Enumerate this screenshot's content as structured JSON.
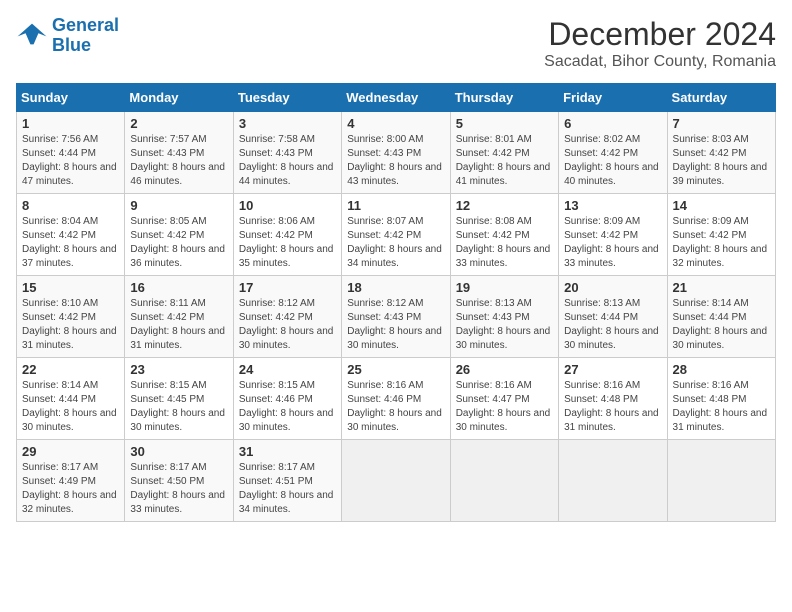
{
  "header": {
    "logo_line1": "General",
    "logo_line2": "Blue",
    "title": "December 2024",
    "subtitle": "Sacadat, Bihor County, Romania"
  },
  "calendar": {
    "columns": [
      "Sunday",
      "Monday",
      "Tuesday",
      "Wednesday",
      "Thursday",
      "Friday",
      "Saturday"
    ],
    "weeks": [
      [
        {
          "day": "1",
          "sunrise": "Sunrise: 7:56 AM",
          "sunset": "Sunset: 4:44 PM",
          "daylight": "Daylight: 8 hours and 47 minutes."
        },
        {
          "day": "2",
          "sunrise": "Sunrise: 7:57 AM",
          "sunset": "Sunset: 4:43 PM",
          "daylight": "Daylight: 8 hours and 46 minutes."
        },
        {
          "day": "3",
          "sunrise": "Sunrise: 7:58 AM",
          "sunset": "Sunset: 4:43 PM",
          "daylight": "Daylight: 8 hours and 44 minutes."
        },
        {
          "day": "4",
          "sunrise": "Sunrise: 8:00 AM",
          "sunset": "Sunset: 4:43 PM",
          "daylight": "Daylight: 8 hours and 43 minutes."
        },
        {
          "day": "5",
          "sunrise": "Sunrise: 8:01 AM",
          "sunset": "Sunset: 4:42 PM",
          "daylight": "Daylight: 8 hours and 41 minutes."
        },
        {
          "day": "6",
          "sunrise": "Sunrise: 8:02 AM",
          "sunset": "Sunset: 4:42 PM",
          "daylight": "Daylight: 8 hours and 40 minutes."
        },
        {
          "day": "7",
          "sunrise": "Sunrise: 8:03 AM",
          "sunset": "Sunset: 4:42 PM",
          "daylight": "Daylight: 8 hours and 39 minutes."
        }
      ],
      [
        {
          "day": "8",
          "sunrise": "Sunrise: 8:04 AM",
          "sunset": "Sunset: 4:42 PM",
          "daylight": "Daylight: 8 hours and 37 minutes."
        },
        {
          "day": "9",
          "sunrise": "Sunrise: 8:05 AM",
          "sunset": "Sunset: 4:42 PM",
          "daylight": "Daylight: 8 hours and 36 minutes."
        },
        {
          "day": "10",
          "sunrise": "Sunrise: 8:06 AM",
          "sunset": "Sunset: 4:42 PM",
          "daylight": "Daylight: 8 hours and 35 minutes."
        },
        {
          "day": "11",
          "sunrise": "Sunrise: 8:07 AM",
          "sunset": "Sunset: 4:42 PM",
          "daylight": "Daylight: 8 hours and 34 minutes."
        },
        {
          "day": "12",
          "sunrise": "Sunrise: 8:08 AM",
          "sunset": "Sunset: 4:42 PM",
          "daylight": "Daylight: 8 hours and 33 minutes."
        },
        {
          "day": "13",
          "sunrise": "Sunrise: 8:09 AM",
          "sunset": "Sunset: 4:42 PM",
          "daylight": "Daylight: 8 hours and 33 minutes."
        },
        {
          "day": "14",
          "sunrise": "Sunrise: 8:09 AM",
          "sunset": "Sunset: 4:42 PM",
          "daylight": "Daylight: 8 hours and 32 minutes."
        }
      ],
      [
        {
          "day": "15",
          "sunrise": "Sunrise: 8:10 AM",
          "sunset": "Sunset: 4:42 PM",
          "daylight": "Daylight: 8 hours and 31 minutes."
        },
        {
          "day": "16",
          "sunrise": "Sunrise: 8:11 AM",
          "sunset": "Sunset: 4:42 PM",
          "daylight": "Daylight: 8 hours and 31 minutes."
        },
        {
          "day": "17",
          "sunrise": "Sunrise: 8:12 AM",
          "sunset": "Sunset: 4:42 PM",
          "daylight": "Daylight: 8 hours and 30 minutes."
        },
        {
          "day": "18",
          "sunrise": "Sunrise: 8:12 AM",
          "sunset": "Sunset: 4:43 PM",
          "daylight": "Daylight: 8 hours and 30 minutes."
        },
        {
          "day": "19",
          "sunrise": "Sunrise: 8:13 AM",
          "sunset": "Sunset: 4:43 PM",
          "daylight": "Daylight: 8 hours and 30 minutes."
        },
        {
          "day": "20",
          "sunrise": "Sunrise: 8:13 AM",
          "sunset": "Sunset: 4:44 PM",
          "daylight": "Daylight: 8 hours and 30 minutes."
        },
        {
          "day": "21",
          "sunrise": "Sunrise: 8:14 AM",
          "sunset": "Sunset: 4:44 PM",
          "daylight": "Daylight: 8 hours and 30 minutes."
        }
      ],
      [
        {
          "day": "22",
          "sunrise": "Sunrise: 8:14 AM",
          "sunset": "Sunset: 4:44 PM",
          "daylight": "Daylight: 8 hours and 30 minutes."
        },
        {
          "day": "23",
          "sunrise": "Sunrise: 8:15 AM",
          "sunset": "Sunset: 4:45 PM",
          "daylight": "Daylight: 8 hours and 30 minutes."
        },
        {
          "day": "24",
          "sunrise": "Sunrise: 8:15 AM",
          "sunset": "Sunset: 4:46 PM",
          "daylight": "Daylight: 8 hours and 30 minutes."
        },
        {
          "day": "25",
          "sunrise": "Sunrise: 8:16 AM",
          "sunset": "Sunset: 4:46 PM",
          "daylight": "Daylight: 8 hours and 30 minutes."
        },
        {
          "day": "26",
          "sunrise": "Sunrise: 8:16 AM",
          "sunset": "Sunset: 4:47 PM",
          "daylight": "Daylight: 8 hours and 30 minutes."
        },
        {
          "day": "27",
          "sunrise": "Sunrise: 8:16 AM",
          "sunset": "Sunset: 4:48 PM",
          "daylight": "Daylight: 8 hours and 31 minutes."
        },
        {
          "day": "28",
          "sunrise": "Sunrise: 8:16 AM",
          "sunset": "Sunset: 4:48 PM",
          "daylight": "Daylight: 8 hours and 31 minutes."
        }
      ],
      [
        {
          "day": "29",
          "sunrise": "Sunrise: 8:17 AM",
          "sunset": "Sunset: 4:49 PM",
          "daylight": "Daylight: 8 hours and 32 minutes."
        },
        {
          "day": "30",
          "sunrise": "Sunrise: 8:17 AM",
          "sunset": "Sunset: 4:50 PM",
          "daylight": "Daylight: 8 hours and 33 minutes."
        },
        {
          "day": "31",
          "sunrise": "Sunrise: 8:17 AM",
          "sunset": "Sunset: 4:51 PM",
          "daylight": "Daylight: 8 hours and 34 minutes."
        },
        null,
        null,
        null,
        null
      ]
    ]
  }
}
